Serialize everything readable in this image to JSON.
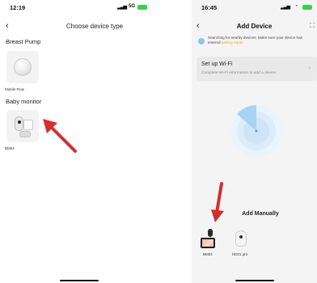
{
  "left_screen": {
    "status": {
      "time": "12:19",
      "network": "5G"
    },
    "nav": {
      "back": "‹",
      "title": "Choose device type"
    },
    "sections": [
      {
        "label": "Breast Pump",
        "device": {
          "name": "Mobile Flow",
          "icon": "breast-pump-image"
        }
      },
      {
        "label": "Baby monitor",
        "device": {
          "name": "BM04",
          "icon": "baby-camera-image"
        }
      }
    ],
    "annotation_color": "#d32f2f"
  },
  "right_screen": {
    "status": {
      "time": "16:45"
    },
    "nav": {
      "back": "‹",
      "title": "Add Device",
      "scan_icon": "scan-icon"
    },
    "notice": {
      "text": "Searching for nearby devices. Make sure your device has entered",
      "highlight": "pairing mode."
    },
    "wifi": {
      "title": "Set up Wi-Fi",
      "subtitle": "Complete Wi-Fi information to add a device.",
      "chevron": "›"
    },
    "manual": {
      "title": "Add Manually",
      "devices": [
        {
          "name": "BM04",
          "icon": "monitor-kit-image"
        },
        {
          "name": "HD01 pro",
          "icon": "camera-image"
        }
      ]
    },
    "colors": {
      "radar": "#a9d3f4",
      "accent": "#f0a020"
    }
  }
}
